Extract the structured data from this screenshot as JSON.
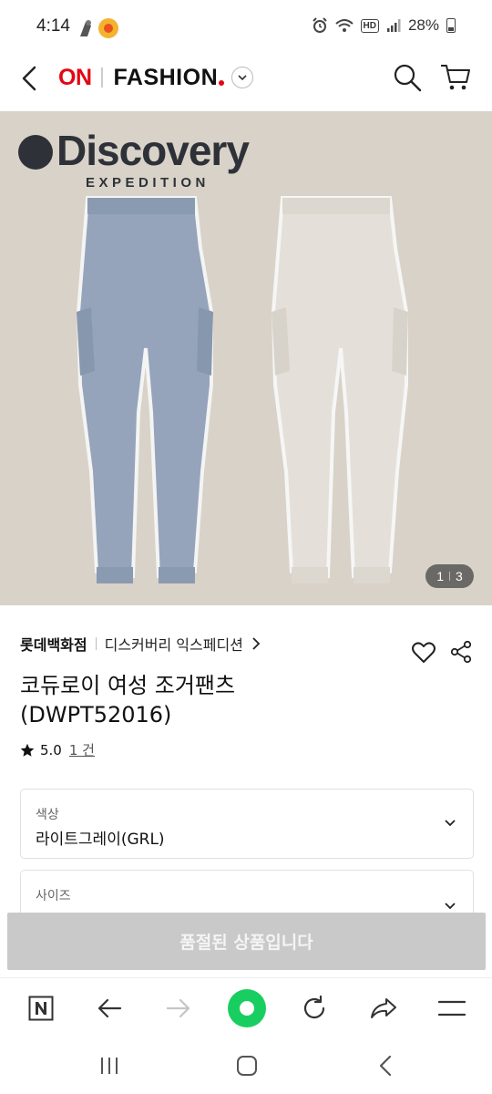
{
  "status_bar": {
    "time": "4:14",
    "hd_badge": "HD",
    "battery": "28%"
  },
  "header": {
    "brand_on": "ON",
    "brand_fashion": "FASHION"
  },
  "product_image": {
    "logo_main": "Discovery",
    "logo_sub": "EXPEDITION",
    "page_current": "1",
    "page_total": "3"
  },
  "product": {
    "store": "롯데백화점",
    "brand": "디스커버리 익스페디션",
    "title_line1": "코듀로이 여성 조거팬츠",
    "title_line2": "(DWPT52016)",
    "rating": "5.0",
    "review_count": "1 건"
  },
  "options": {
    "color_label": "색상",
    "color_value": "라이트그레이(GRL)",
    "size_label": "사이즈"
  },
  "soldout_label": "품절된 상품입니다",
  "colors": {
    "brand_red": "#e30613",
    "naver_green": "#19ce60",
    "soldout_gray": "#c9c9c9"
  }
}
